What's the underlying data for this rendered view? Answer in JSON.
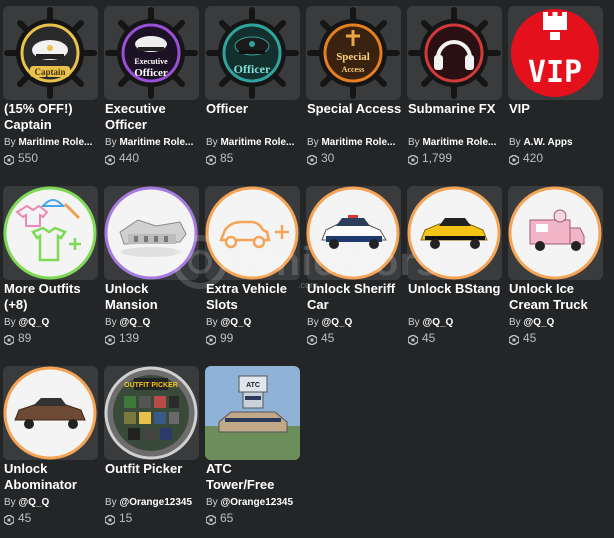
{
  "items": [
    {
      "title": "(15% OFF!) Captain",
      "creator_prefix": "By",
      "creator": "Maritime Role...",
      "price": "550",
      "icon": "captain-badge-icon"
    },
    {
      "title": "Executive Officer",
      "creator_prefix": "By",
      "creator": "Maritime Role...",
      "price": "440",
      "icon": "executive-officer-badge-icon"
    },
    {
      "title": "Officer",
      "creator_prefix": "By",
      "creator": "Maritime Role...",
      "price": "85",
      "icon": "officer-badge-icon"
    },
    {
      "title": "Special Access",
      "creator_prefix": "By",
      "creator": "Maritime Role...",
      "price": "30",
      "icon": "special-access-badge-icon"
    },
    {
      "title": "Submarine FX",
      "creator_prefix": "By",
      "creator": "Maritime Role...",
      "price": "1,799",
      "icon": "headphones-badge-icon"
    },
    {
      "title": "VIP",
      "creator_prefix": "By",
      "creator": "A.W. Apps",
      "price": "420",
      "icon": "vip-crown-icon"
    },
    {
      "title": "More Outfits (+8)",
      "creator_prefix": "By",
      "creator": "@Q_Q",
      "price": "89",
      "icon": "outfits-icon"
    },
    {
      "title": "Unlock Mansion",
      "creator_prefix": "By",
      "creator": "@Q_Q",
      "price": "139",
      "icon": "mansion-icon"
    },
    {
      "title": "Extra Vehicle Slots",
      "creator_prefix": "By",
      "creator": "@Q_Q",
      "price": "99",
      "icon": "car-plus-icon"
    },
    {
      "title": "Unlock Sheriff Car",
      "creator_prefix": "By",
      "creator": "@Q_Q",
      "price": "45",
      "icon": "sheriff-car-icon"
    },
    {
      "title": "Unlock BStang",
      "creator_prefix": "By",
      "creator": "@Q_Q",
      "price": "45",
      "icon": "yellow-car-icon"
    },
    {
      "title": "Unlock Ice Cream Truck",
      "creator_prefix": "By",
      "creator": "@Q_Q",
      "price": "45",
      "icon": "ice-cream-truck-icon"
    },
    {
      "title": "Unlock Abominator",
      "creator_prefix": "By",
      "creator": "@Q_Q",
      "price": "45",
      "icon": "abominator-car-icon"
    },
    {
      "title": "Outfit Picker",
      "creator_prefix": "By",
      "creator": "@Orange12345",
      "price": "15",
      "icon": "outfit-picker-icon"
    },
    {
      "title": "ATC Tower/Free",
      "creator_prefix": "By",
      "creator": "@Orange12345",
      "price": "65",
      "icon": "atc-tower-icon"
    }
  ],
  "badge_text": {
    "captain": "Captain",
    "executive": "Executive Officer",
    "officer": "Officer",
    "special": "Special Access",
    "vip": "VIP",
    "outfit_picker": "OUTFIT PICKER",
    "atc": "ATC"
  },
  "watermark": {
    "text": "fenicolors",
    "suffix": ".com"
  },
  "colors": {
    "background": "#232527",
    "tile": "#393b3d",
    "wheel": "#1a1a1a",
    "captain_ring": "#e8c24a",
    "exec_ring": "#9a4fd6",
    "officer_ring": "#2fa39c",
    "special_ring": "#e67e22",
    "sub_ring": "#d23a3a",
    "vip_red": "#e4101c",
    "outfits_ring": "#7ed957",
    "mansion_ring": "#a57be0",
    "orange_ring": "#f5a455"
  }
}
